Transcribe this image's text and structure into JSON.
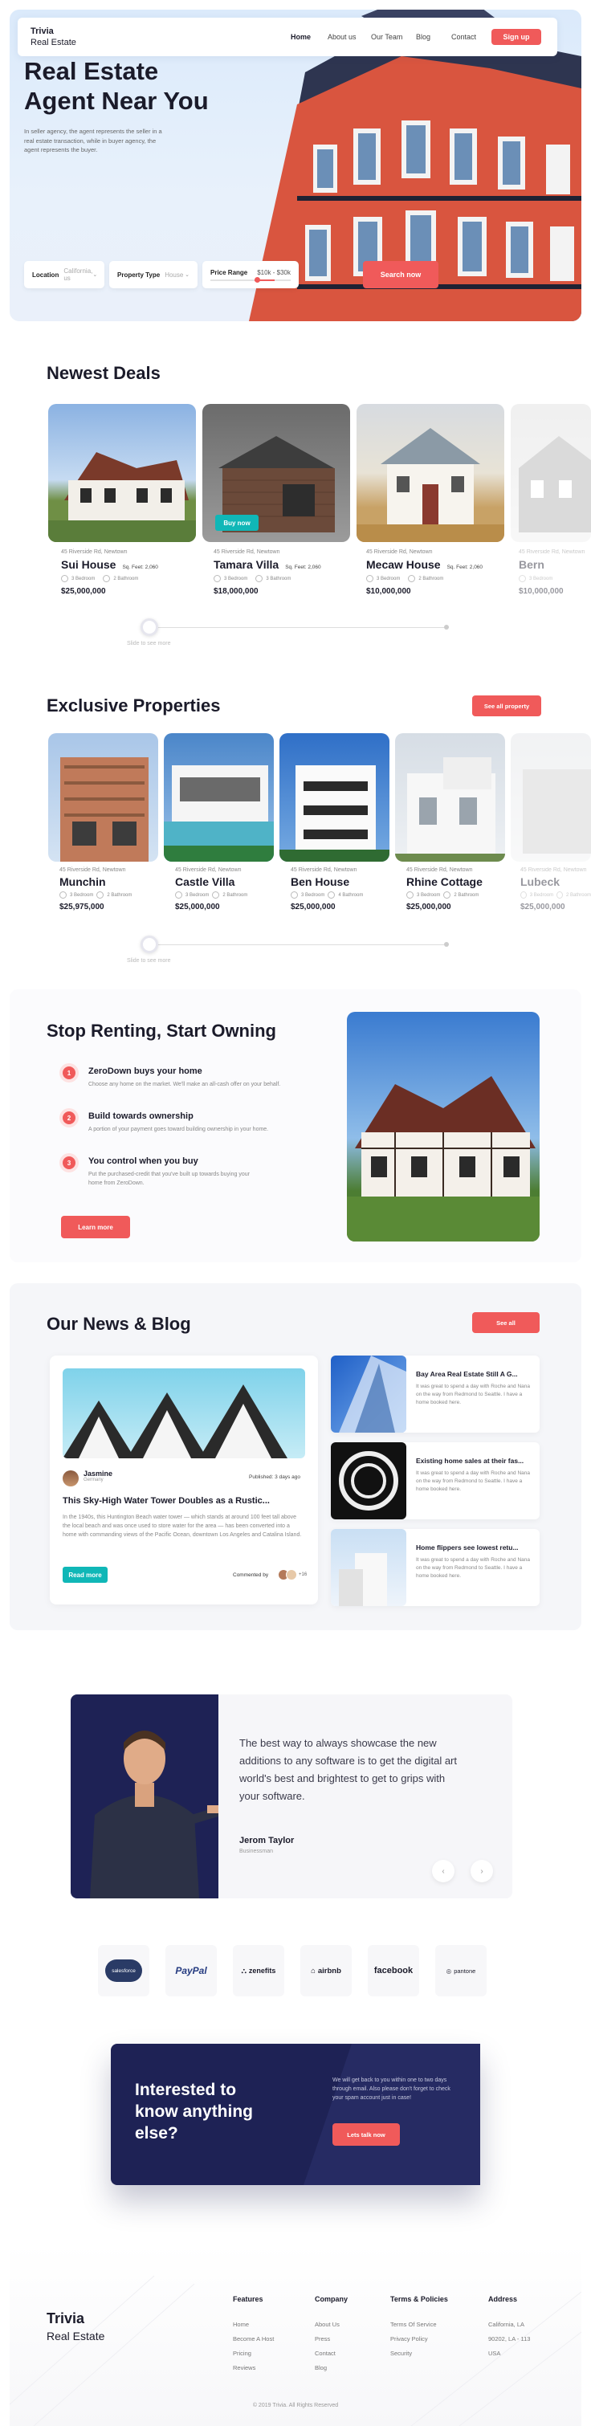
{
  "brand": {
    "line1": "Trivia",
    "line2": "Real Estate"
  },
  "nav": {
    "links": [
      "Home",
      "About us",
      "Our Team",
      "Blog",
      "Contact"
    ],
    "cta": "Sign up"
  },
  "hero": {
    "title_line1": "Real Estate",
    "title_line2": "Agent Near You",
    "description": "In seller agency, the agent represents the seller in a real estate transaction, while in buyer agency, the agent represents the buyer.",
    "search": {
      "location_label": "Location",
      "location_value": "California, us",
      "type_label": "Property Type",
      "type_value": "House",
      "price_label": "Price Range",
      "price_value": "$10k - $30k",
      "button": "Search now"
    }
  },
  "newest": {
    "title": "Newest Deals",
    "buy_button": "Buy now",
    "cards": [
      {
        "addr": "45 Riverside Rd, Newtown",
        "name": "Sui House",
        "feet": "Sq. Feet: 2,060",
        "bed": "3 Bedroom",
        "bath": "2 Bathroom",
        "price": "$25,000,000"
      },
      {
        "addr": "45 Riverside Rd, Newtown",
        "name": "Tamara Villa",
        "feet": "Sq. Feet: 2,060",
        "bed": "3 Bedroom",
        "bath": "3 Bathroom",
        "price": "$18,000,000"
      },
      {
        "addr": "45 Riverside Rd, Newtown",
        "name": "Mecaw House",
        "feet": "Sq. Feet: 2,060",
        "bed": "3 Bedroom",
        "bath": "2 Bathroom",
        "price": "$10,000,000"
      },
      {
        "addr": "45 Riverside Rd, Newtown",
        "name": "Bern",
        "feet": "",
        "bed": "3 Bedroom",
        "bath": "",
        "price": "$10,000,000"
      }
    ],
    "slider_label": "Slide to see more"
  },
  "exclusive": {
    "title": "Exclusive Properties",
    "see_all": "See all property",
    "cards": [
      {
        "addr": "45 Riverside Rd, Newtown",
        "name": "Munchin",
        "bed": "3 Bedroom",
        "bath": "2 Bathroom",
        "price": "$25,975,000"
      },
      {
        "addr": "45 Riverside Rd, Newtown",
        "name": "Castle Villa",
        "bed": "3 Bedroom",
        "bath": "2 Bathroom",
        "price": "$25,000,000"
      },
      {
        "addr": "45 Riverside Rd, Newtown",
        "name": "Ben House",
        "bed": "3 Bedroom",
        "bath": "4 Bathroom",
        "price": "$25,000,000"
      },
      {
        "addr": "45 Riverside Rd, Newtown",
        "name": "Rhine Cottage",
        "bed": "3 Bedroom",
        "bath": "2 Bathroom",
        "price": "$25,000,000"
      },
      {
        "addr": "45 Riverside Rd, Newtown",
        "name": "Lubeck",
        "bed": "3 Bedroom",
        "bath": "2 Bathroom",
        "price": "$25,000,000"
      }
    ],
    "slider_label": "Slide to see more"
  },
  "owning": {
    "title": "Stop Renting, Start Owning",
    "steps": [
      {
        "num": "1",
        "title": "ZeroDown buys your home",
        "desc": "Choose any home on the market. We'll make an all-cash offer on your behalf."
      },
      {
        "num": "2",
        "title": "Build towards ownership",
        "desc": "A portion of your payment goes toward building ownership in your home."
      },
      {
        "num": "3",
        "title": "You control when you buy",
        "desc": "Put the purchased-credit that you've built up towards buying your home from ZeroDown."
      }
    ],
    "button": "Learn more"
  },
  "blog": {
    "title": "Our News & Blog",
    "see_all": "See all",
    "main": {
      "author": "Jasmine",
      "location": "Germany",
      "published": "Published: 3 days ago",
      "headline": "This Sky-High Water Tower Doubles as a Rustic...",
      "body": "In the 1940s, this Huntington Beach water tower — which stands at around 100 feet tall above the local beach and was once used to store water for the area — has been converted into a home with commanding views of the Pacific Ocean, downtown Los Angeles and Catalina Island.",
      "read_more": "Read more",
      "commented": "Commented by",
      "comment_count": "+16"
    },
    "side": [
      {
        "title": "Bay Area Real Estate Still A G...",
        "desc": "It was great to spend a day with Roche and Nana on the way from Redmond to Seattle. I have a home booked here."
      },
      {
        "title": "Existing home sales at their fas...",
        "desc": "It was great to spend a day with Roche and Nana on the way from Redmond to Seattle. I have a home booked here."
      },
      {
        "title": "Home flippers see lowest retu...",
        "desc": "It was great to spend a day with Roche and Nana on the way from Redmond to Seattle. I have a home booked here."
      }
    ]
  },
  "testimonial": {
    "quote": "The best way to always showcase the new additions to any software is to get the digital art world's best and brightest to get to grips with your software.",
    "name": "Jerom Taylor",
    "role": "Businessman"
  },
  "logos": [
    "salesforce",
    "PayPal",
    "zenefits",
    "airbnb",
    "facebook",
    "pantone"
  ],
  "cta": {
    "title": "Interested to know anything else?",
    "text": "We will get back to you within one to two days through email. Also please don't forget to check your spam account just in case!",
    "button": "Lets talk now"
  },
  "footer": {
    "columns": [
      {
        "title": "Features",
        "links": [
          "Home",
          "Become A Host",
          "Pricing",
          "Reviews"
        ]
      },
      {
        "title": "Company",
        "links": [
          "About Us",
          "Press",
          "Contact",
          "Blog"
        ]
      },
      {
        "title": "Terms & Policies",
        "links": [
          "Terms Of Service",
          "Privacy Policy",
          "Security"
        ]
      },
      {
        "title": "Address",
        "links": [
          "California, LA",
          "90202, LA - 113",
          "USA"
        ]
      }
    ],
    "copyright": "© 2019 Trivia. All Rights Reserved"
  },
  "colors": {
    "accent": "#f05a5a",
    "teal": "#10b7b7",
    "navy": "#1e2255"
  }
}
